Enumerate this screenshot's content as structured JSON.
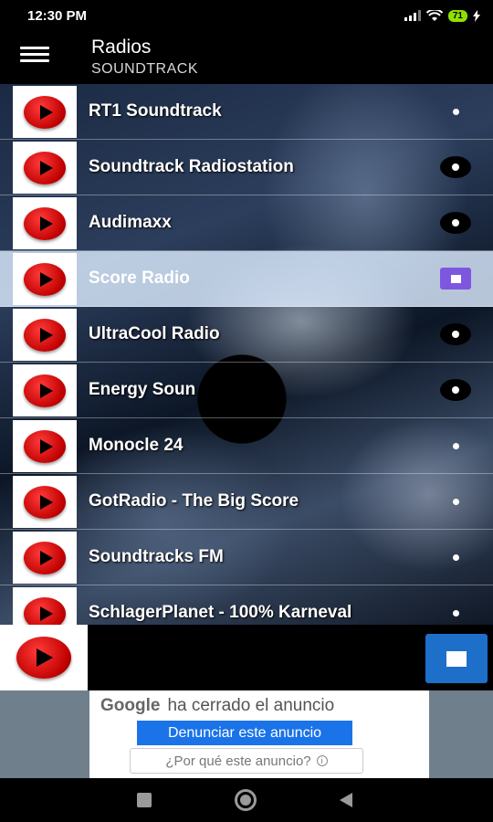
{
  "status": {
    "time": "12:30 PM",
    "battery": "71"
  },
  "appbar": {
    "title": "Radios",
    "subtitle": "SOUNDTRACK"
  },
  "stations": [
    {
      "name": "RT1 Soundtrack",
      "control": "dot"
    },
    {
      "name": "Soundtrack Radiostation",
      "control": "dot-dark"
    },
    {
      "name": "Audimaxx",
      "control": "dot-dark"
    },
    {
      "name": "Score Radio",
      "control": "stop",
      "selected": true
    },
    {
      "name": "UltraCool Radio",
      "control": "dot-dark"
    },
    {
      "name": "Energy Soun",
      "control": "dot-dark"
    },
    {
      "name": "Monocle 24",
      "control": "dot"
    },
    {
      "name": "GotRadio - The Big Score",
      "control": "dot"
    },
    {
      "name": "Soundtracks FM",
      "control": "dot"
    },
    {
      "name": "SchlagerPlanet - 100% Karneval",
      "control": "dot"
    }
  ],
  "ad": {
    "brand": "Google",
    "message": "ha cerrado el anuncio",
    "report_label": "Denunciar este anuncio",
    "why_label": "¿Por qué este anuncio?",
    "info_glyph": "i"
  },
  "colors": {
    "selected_row": "#dcebff",
    "stop_button": "#7e57e0",
    "fab": "#1e6fc9",
    "report_button": "#1a73e8"
  },
  "icons": {
    "menu": "hamburger-icon",
    "play": "play-icon",
    "stop": "stop-icon"
  }
}
